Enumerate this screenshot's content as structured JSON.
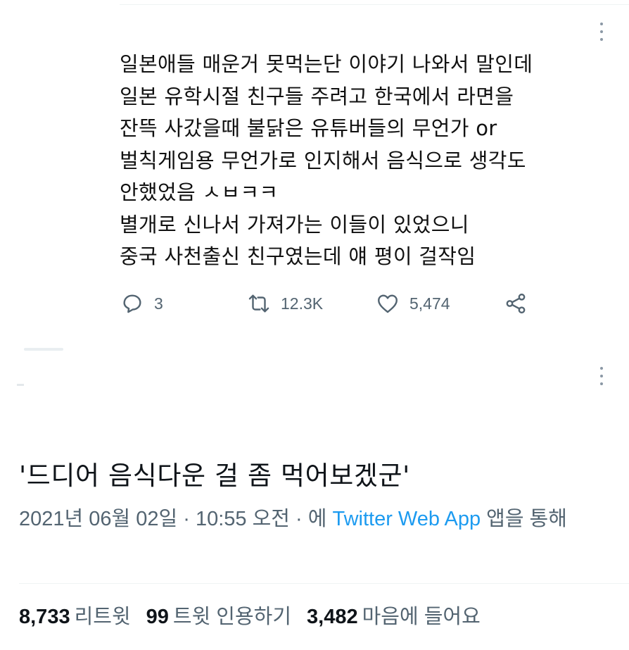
{
  "tweet_reply": {
    "text_lines": [
      "일본애들 매운거 못먹는단 이야기 나와서 말인데",
      "일본 유학시절 친구들 주려고 한국에서 라면을",
      "잔뜩 사갔을때 불닭은 유튜버들의 무언가 or",
      "벌칙게임용 무언가로 인지해서 음식으로 생각도",
      "안했었음 ㅅㅂㅋㅋ",
      "별개로 신나서 가져가는 이들이 있었으니",
      "중국 사천출신 친구였는데 얘 평이 걸작임"
    ],
    "actions": {
      "reply_icon": "reply-icon",
      "reply_count": "3",
      "retweet_icon": "retweet-icon",
      "retweet_count": "12.3K",
      "like_icon": "heart-icon",
      "like_count": "5,474",
      "share_icon": "share-icon"
    }
  },
  "main_tweet": {
    "text": "'드디어 음식다운 걸 좀 먹어보겠군'",
    "timestamp": "2021년 06월 02일 · 10:55 오전 · 에 ",
    "source_app": "Twitter Web App",
    "source_suffix": " 앱을 통해"
  },
  "stats": {
    "retweets_value": "8,733",
    "retweets_label": "리트윗",
    "quotes_value": "99",
    "quotes_label": "트윗 인용하기",
    "likes_value": "3,482",
    "likes_label": "마음에 들어요"
  },
  "colors": {
    "link": "#1d9bf0",
    "muted": "#536471",
    "text": "#0f1419"
  }
}
